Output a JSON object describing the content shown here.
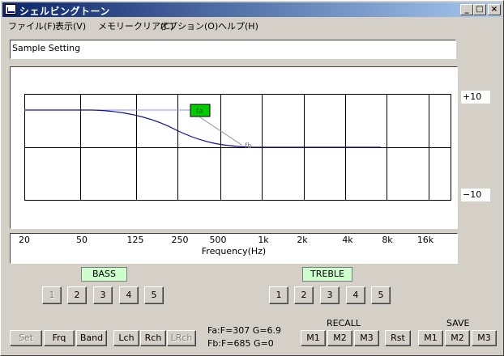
{
  "window": {
    "title": "シェルビングトーン",
    "minimize_glyph": "_",
    "maximize_glyph": "□",
    "close_glyph": "×"
  },
  "menu": [
    "ファイル(F)",
    "表示(V)",
    "メモリークリア(C)",
    "オプション(O)",
    "ヘルプ(H)"
  ],
  "setting_name": "Sample Setting",
  "scale": {
    "top": "+10",
    "bottom": "−10"
  },
  "markers": {
    "fa": "fa",
    "fb": "fb"
  },
  "frequency": {
    "ticks": [
      "20",
      "50",
      "125",
      "250",
      "500",
      "1k",
      "2k",
      "4k",
      "8k",
      "16k"
    ],
    "axis_label": "Frequency(Hz)"
  },
  "bass": {
    "label": "BASS",
    "presets": [
      "1",
      "2",
      "3",
      "4",
      "5"
    ]
  },
  "treble": {
    "label": "TREBLE",
    "presets": [
      "1",
      "2",
      "3",
      "4",
      "5"
    ]
  },
  "controls": {
    "set": "Set",
    "frq": "Frq",
    "band": "Band",
    "lch": "Lch",
    "rch": "Rch",
    "lrch": "LRch"
  },
  "info": {
    "fa": "Fa:F=307 G=6.9",
    "fb": "Fb:F=685 G=0"
  },
  "recall": {
    "label": "RECALL",
    "buttons": [
      "M1",
      "M2",
      "M3"
    ]
  },
  "reset": "Rst",
  "save": {
    "label": "SAVE",
    "buttons": [
      "M1",
      "M2",
      "M3"
    ]
  },
  "colors": {
    "curve": "#1010a0",
    "handle": "#00cc00",
    "band_label_bg": "#ccffcc"
  }
}
